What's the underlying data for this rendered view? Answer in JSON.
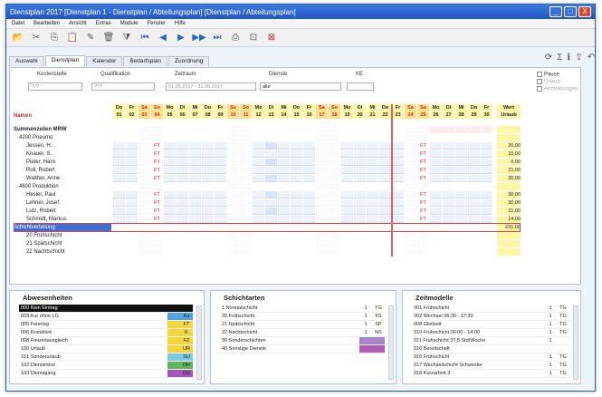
{
  "window": {
    "title": "Dienstplan 2017  [Dienstplan 1 - Dienstplan / Abteilungsplan]  [Dienstplan / Abteilungsplan]",
    "minimize": "_",
    "maximize": "□",
    "close": "X"
  },
  "menu": [
    "Datei",
    "Bearbeiten",
    "Ansicht",
    "Extras",
    "Module",
    "Fenster",
    "Hilfe"
  ],
  "toolbar_icons": [
    "folder-icon",
    "scissors-icon",
    "copy-icon",
    "paste-icon",
    "pencil-icon",
    "trash-icon",
    "funnel-icon",
    "first-icon",
    "prev-icon",
    "play-icon",
    "next-icon",
    "last-icon",
    "print-icon",
    "preview-icon",
    "cancel-icon"
  ],
  "tabs": [
    "Auswahl",
    "Dienstplan",
    "Kalender",
    "Bedarfsplan",
    "Zuordnung"
  ],
  "tab_icons": [
    "refresh-icon",
    "sum-icon",
    "info-icon",
    "export-icon",
    "undo-icon"
  ],
  "filters": {
    "labels": [
      "Kostenstelle",
      "Qualifikation",
      "Zeitraum",
      "Dienste",
      "KE"
    ],
    "values": [
      "???",
      "???",
      "01.05.2017 - 31.05.2017",
      "alle",
      ""
    ],
    "checkboxes": [
      "Pause",
      "Urlaub",
      "Anmeldungen"
    ]
  },
  "grid": {
    "name_header": "Namen",
    "days": [
      {
        "wd": "Do",
        "d": "01"
      },
      {
        "wd": "Fr",
        "d": "02"
      },
      {
        "wd": "Sa",
        "d": "03"
      },
      {
        "wd": "So",
        "d": "04"
      },
      {
        "wd": "Mo",
        "d": "05"
      },
      {
        "wd": "Di",
        "d": "06"
      },
      {
        "wd": "Mi",
        "d": "07"
      },
      {
        "wd": "Do",
        "d": "08"
      },
      {
        "wd": "Fr",
        "d": "09"
      },
      {
        "wd": "Sa",
        "d": "10"
      },
      {
        "wd": "So",
        "d": "11"
      },
      {
        "wd": "Mo",
        "d": "12"
      },
      {
        "wd": "Di",
        "d": "13"
      },
      {
        "wd": "Mi",
        "d": "14"
      },
      {
        "wd": "Do",
        "d": "15"
      },
      {
        "wd": "Fr",
        "d": "16"
      },
      {
        "wd": "Sa",
        "d": "17"
      },
      {
        "wd": "So",
        "d": "18"
      },
      {
        "wd": "Mo",
        "d": "19"
      },
      {
        "wd": "Di",
        "d": "20"
      },
      {
        "wd": "Mi",
        "d": "21"
      },
      {
        "wd": "Do",
        "d": "22"
      },
      {
        "wd": "Fr",
        "d": "23"
      },
      {
        "wd": "Sa",
        "d": "24"
      },
      {
        "wd": "So",
        "d": "25"
      },
      {
        "wd": "Mo",
        "d": "26"
      },
      {
        "wd": "Di",
        "d": "27"
      },
      {
        "wd": "Mi",
        "d": "28"
      },
      {
        "wd": "Do",
        "d": "29"
      },
      {
        "wd": "Fr",
        "d": "30"
      }
    ],
    "sum_header": "Wert Urlaub",
    "rows": [
      {
        "name": "Summenzeilen MRW",
        "type": "group",
        "sum": ""
      },
      {
        "name": "4200 Pneumo",
        "type": "sub",
        "sum": ""
      },
      {
        "name": "Jessen, H.",
        "type": "person",
        "sum": "20,00"
      },
      {
        "name": "Knauer, S.",
        "type": "person",
        "sum": "10,00"
      },
      {
        "name": "Pieter, Hans",
        "type": "person",
        "sum": "0,00"
      },
      {
        "name": "Roll, Robert",
        "type": "person",
        "sum": "21,00"
      },
      {
        "name": "Walther, Anne",
        "type": "person",
        "sum": "30,00"
      },
      {
        "name": "4600 Produktion",
        "type": "sub",
        "sum": ""
      },
      {
        "name": "Hesler, Paul",
        "type": "person",
        "sum": "30,00"
      },
      {
        "name": "Lehner, Josef",
        "type": "person",
        "sum": "30,00"
      },
      {
        "name": "Lutz, Robert",
        "type": "person",
        "sum": "21,00"
      },
      {
        "name": "Schmidt, Markus",
        "type": "person",
        "sum": "14,00"
      },
      {
        "name": "Schichtverteilung",
        "type": "selected",
        "sum": "231,00"
      },
      {
        "name": "20 Frühschicht",
        "type": "count",
        "sum": ""
      },
      {
        "name": "21 Spätschicht",
        "type": "count",
        "sum": ""
      },
      {
        "name": "22 Nachtschicht",
        "type": "count",
        "sum": ""
      }
    ],
    "codes": {
      "f": "FT",
      "u": "U"
    }
  },
  "absence": {
    "title": "Abwesenheiten",
    "items": [
      {
        "name": "000 Kein Eintrag",
        "c1": "",
        "c2": ""
      },
      {
        "name": "003 Kur ohne LG",
        "c1": "",
        "c2": "Ku"
      },
      {
        "name": "005 Feiertag",
        "c1": "",
        "c2": "FT"
      },
      {
        "name": "006 Krankheit",
        "c1": "",
        "c2": "K"
      },
      {
        "name": "008 Freizeitausgleich",
        "c1": "",
        "c2": "FZ"
      },
      {
        "name": "100 Urlaub",
        "c1": "",
        "c2": "UR"
      },
      {
        "name": "101 Sonderurlaub",
        "c1": "",
        "c2": "SU"
      },
      {
        "name": "102 Dienstreise",
        "c1": "",
        "c2": "DR"
      },
      {
        "name": "103 Dienstgang",
        "c1": "",
        "c2": "DG"
      }
    ]
  },
  "shifts": {
    "title": "Schichtarten",
    "items": [
      {
        "name": "1 Normalschicht",
        "c1": "1",
        "c2": "TG"
      },
      {
        "name": "20 Frühschicht",
        "c1": "1",
        "c2": "FS"
      },
      {
        "name": "21 Spätschicht",
        "c1": "1",
        "c2": "SP"
      },
      {
        "name": "22 Nachtschicht",
        "c1": "1",
        "c2": "NS"
      },
      {
        "name": "30 Sonderschichten",
        "c1": "",
        "c2": ""
      },
      {
        "name": "40 Sonstige Dienste",
        "c1": "",
        "c2": ""
      }
    ]
  },
  "times": {
    "title": "Zeitmodelle",
    "items": [
      {
        "name": "001 Frühschicht",
        "c1": "1",
        "c2": "TG"
      },
      {
        "name": "002 Wechsel 06:30 - 17:30",
        "c1": "1",
        "c2": "TG"
      },
      {
        "name": "008 Gleitzeit",
        "c1": "1",
        "c2": "TG"
      },
      {
        "name": "010 Frühschicht 06:00 - 14:00",
        "c1": "1",
        "c2": "TG"
      },
      {
        "name": "011 Frühschicht 37,5 Std/Woche",
        "c1": "1",
        "c2": ""
      },
      {
        "name": "016 Bereitschaft",
        "c1": "",
        "c2": ""
      },
      {
        "name": "016 Frühschicht",
        "c1": "1",
        "c2": "TG"
      },
      {
        "name": "017 Wechselschicht Schwester",
        "c1": "1",
        "c2": "TG"
      },
      {
        "name": "018 Kurzarbeit 3",
        "c1": "1",
        "c2": "TG"
      }
    ]
  }
}
